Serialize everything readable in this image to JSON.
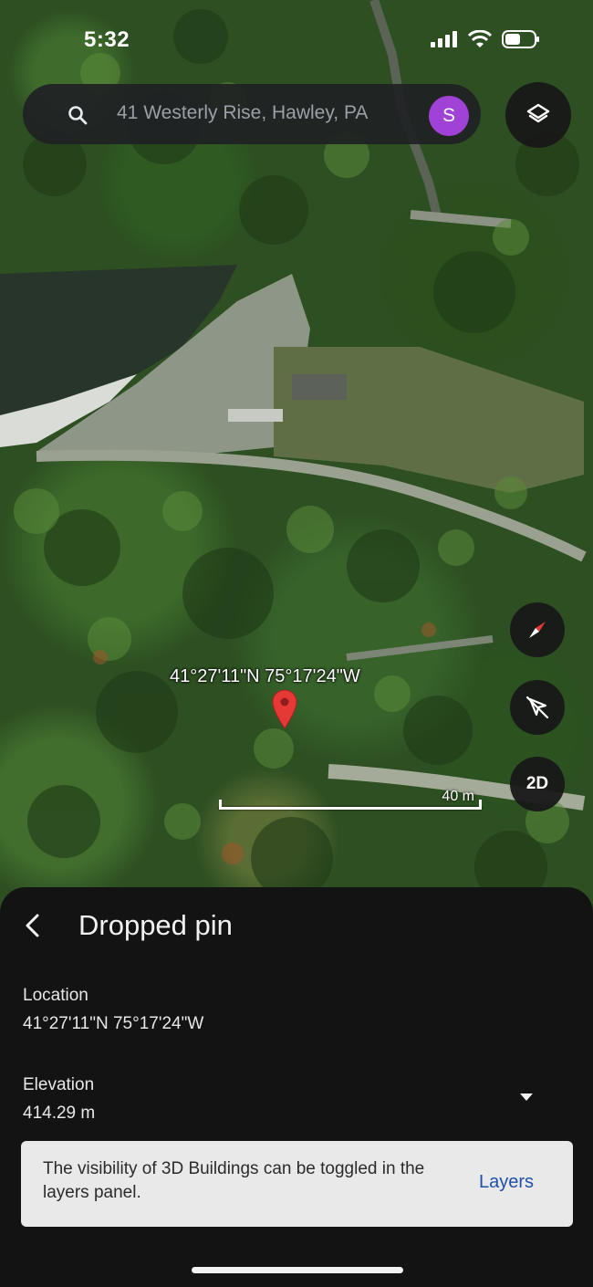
{
  "status_bar": {
    "time": "5:32"
  },
  "search": {
    "text": "41 Westerly Rise, Hawley, PA"
  },
  "account": {
    "initial": "S",
    "color": "#a142d6"
  },
  "map": {
    "pin_coordinates": "41°27'11\"N 75°17'24\"W",
    "scale_label": "40 m",
    "view_mode_label": "2D"
  },
  "sheet": {
    "title": "Dropped pin",
    "location_label": "Location",
    "location_value": "41°27'11\"N 75°17'24\"W",
    "elevation_label": "Elevation",
    "elevation_value": "414.29 m"
  },
  "snackbar": {
    "message": "The visibility of 3D Buildings can be toggled in the layers panel.",
    "action": "Layers"
  },
  "icons": {
    "search": "search-icon",
    "layers": "layers-icon",
    "compass": "compass-icon",
    "tilt": "tilt-icon",
    "back": "chevron-left-icon",
    "expand": "caret-down-icon",
    "pin": "map-pin-icon"
  },
  "colors": {
    "pin": "#e53935",
    "link": "#1f4fa8",
    "sheet_bg": "#131313"
  }
}
